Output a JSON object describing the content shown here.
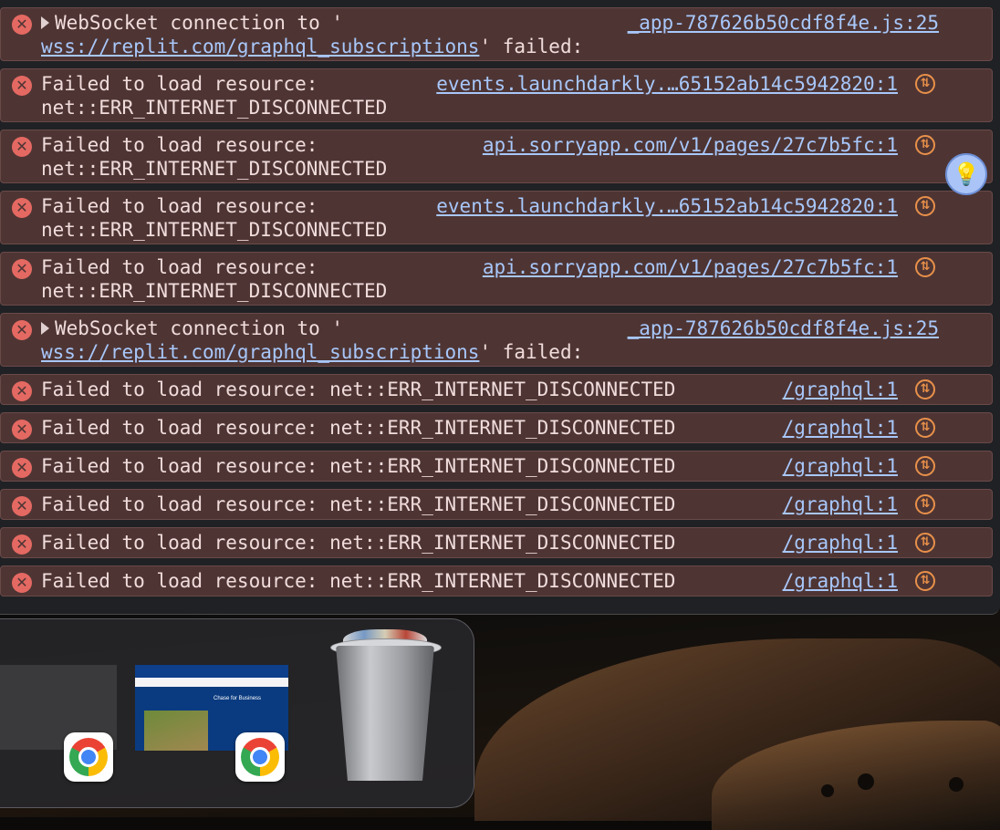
{
  "console": {
    "entries": [
      {
        "type": "error",
        "expandable": false,
        "line1": "Failed to load resource: net::ERR_INTERNET_DISCONNECTED",
        "line2": "",
        "source": "/graphql:1",
        "network_icon": true
      },
      {
        "type": "error",
        "expandable": true,
        "line1": "WebSocket connection to '",
        "line2_link": "wss://replit.com/graphql_subscriptions",
        "line2_tail": "' failed:",
        "source": "_app-787626b50cdf8f4e.js:25",
        "network_icon": false
      },
      {
        "type": "error",
        "expandable": false,
        "line1": "Failed to load resource:",
        "line2": "net::ERR_INTERNET_DISCONNECTED",
        "source": "events.launchdarkly.…65152ab14c5942820:1",
        "network_icon": true
      },
      {
        "type": "error",
        "expandable": false,
        "line1": "Failed to load resource:",
        "line2": "net::ERR_INTERNET_DISCONNECTED",
        "source": "api.sorryapp.com/v1/pages/27c7b5fc:1",
        "network_icon": true
      },
      {
        "type": "error",
        "expandable": false,
        "line1": "Failed to load resource:",
        "line2": "net::ERR_INTERNET_DISCONNECTED",
        "source": "events.launchdarkly.…65152ab14c5942820:1",
        "network_icon": true
      },
      {
        "type": "error",
        "expandable": false,
        "line1": "Failed to load resource:",
        "line2": "net::ERR_INTERNET_DISCONNECTED",
        "source": "api.sorryapp.com/v1/pages/27c7b5fc:1",
        "network_icon": true
      },
      {
        "type": "error",
        "expandable": true,
        "line1": "WebSocket connection to '",
        "line2_link": "wss://replit.com/graphql_subscriptions",
        "line2_tail": "' failed:",
        "source": "_app-787626b50cdf8f4e.js:25",
        "network_icon": false
      },
      {
        "type": "error",
        "expandable": false,
        "line1": "Failed to load resource: net::ERR_INTERNET_DISCONNECTED",
        "line2": "",
        "source": "/graphql:1",
        "network_icon": true
      },
      {
        "type": "error",
        "expandable": false,
        "line1": "Failed to load resource: net::ERR_INTERNET_DISCONNECTED",
        "line2": "",
        "source": "/graphql:1",
        "network_icon": true
      },
      {
        "type": "error",
        "expandable": false,
        "line1": "Failed to load resource: net::ERR_INTERNET_DISCONNECTED",
        "line2": "",
        "source": "/graphql:1",
        "network_icon": true
      },
      {
        "type": "error",
        "expandable": false,
        "line1": "Failed to load resource: net::ERR_INTERNET_DISCONNECTED",
        "line2": "",
        "source": "/graphql:1",
        "network_icon": true
      },
      {
        "type": "error",
        "expandable": false,
        "line1": "Failed to load resource: net::ERR_INTERNET_DISCONNECTED",
        "line2": "",
        "source": "/graphql:1",
        "network_icon": true
      },
      {
        "type": "error",
        "expandable": false,
        "line1": "Failed to load resource: net::ERR_INTERNET_DISCONNECTED",
        "line2": "",
        "source": "/graphql:1",
        "network_icon": true
      }
    ],
    "icons": {
      "error": "error-x-icon",
      "network": "network-request-icon",
      "ai": "ai-assist-lightbulb-icon"
    },
    "colors": {
      "error_bg": "#4e3534",
      "error_text": "#f1dcdc",
      "link": "#a8c7fa",
      "error_icon": "#e46962",
      "network_icon": "#e8904a"
    }
  },
  "dock": {
    "items": [
      {
        "name": "Chrome window thumbnail",
        "icon": "window-thumbnail"
      },
      {
        "name": "Google Chrome",
        "icon": "chrome-icon"
      },
      {
        "name": "Chase for Business window thumbnail",
        "icon": "window-thumbnail",
        "thumb_title": "Chase for Business"
      },
      {
        "name": "Google Chrome",
        "icon": "chrome-icon"
      },
      {
        "name": "Trash",
        "icon": "trash-icon"
      }
    ]
  }
}
